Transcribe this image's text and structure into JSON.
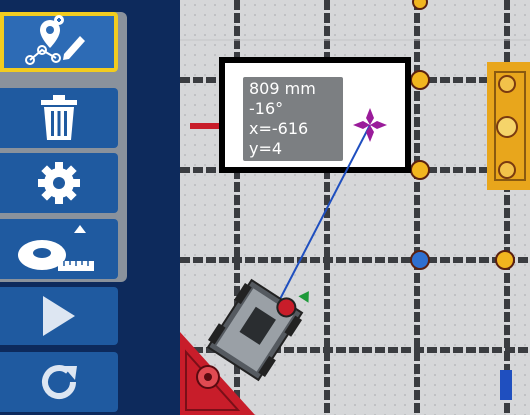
{
  "toolbar": {
    "buttons": [
      {
        "name": "path-edit-tool",
        "icon": "map-pin-path-edit-icon",
        "selected": true
      },
      {
        "name": "delete-tool",
        "icon": "trash-icon",
        "selected": false
      },
      {
        "name": "settings-tool",
        "icon": "gear-icon",
        "selected": false
      },
      {
        "name": "measure-tool",
        "icon": "tape-measure-icon",
        "selected": false
      },
      {
        "name": "play-button",
        "icon": "play-icon",
        "selected": false
      },
      {
        "name": "reset-button",
        "icon": "reset-icon",
        "selected": false
      }
    ],
    "colors": {
      "background": "#0d2a5c",
      "button": "#1f5aa0",
      "selected_outline": "#f2cc1f",
      "group": "#8a929c"
    }
  },
  "measurement": {
    "distance": "809 mm",
    "angle": "-16°",
    "x": "x=-616",
    "y": "y=4"
  },
  "colors": {
    "field_tile": "#d6d7d9",
    "field_line": "#3a3c40",
    "path_line": "#1f4fbf",
    "target_cross": "#9a1b9a",
    "red_corner": "#c81d2a",
    "yellow_goal": "#e8a61c"
  }
}
